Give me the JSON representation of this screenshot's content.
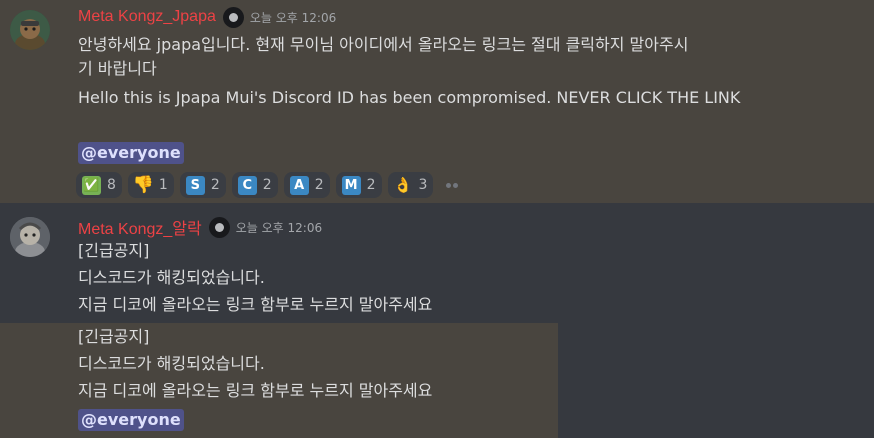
{
  "messages": [
    {
      "username": "Meta Kongz_Jpapa",
      "timestamp": "오늘 오후 12:06",
      "lines": [
        "안녕하세요 jpapa입니다. 현재 무이님 아이디에서 올라오는 링크는 절대 클릭하지 말아주시",
        "기 바랍니다",
        "Hello this is Jpapa Mui's Discord ID has been compromised. NEVER CLICK THE LINK"
      ],
      "mention": "@everyone",
      "reactions": [
        {
          "emoji": "✅",
          "count": "8"
        },
        {
          "emoji": "👎",
          "count": "1"
        },
        {
          "emoji": "S",
          "count": "2"
        },
        {
          "emoji": "C",
          "count": "2"
        },
        {
          "emoji": "A",
          "count": "2"
        },
        {
          "emoji": "M",
          "count": "2"
        },
        {
          "emoji": "👌",
          "count": "3"
        }
      ]
    },
    {
      "username": "Meta Kongz_알락",
      "timestamp": "오늘 오후 12:06",
      "lines": [
        "[긴급공지]",
        "디스코드가 해킹되었습니다.",
        "지금 디코에 올라오는 링크 함부로 누르지 말아주세요"
      ]
    },
    {
      "lines": [
        "[긴급공지]",
        "디스코드가 해킹되었습니다.",
        "지금 디코에 올라오는 링크 함부로 누르지 말아주세요"
      ],
      "mention": "@everyone"
    }
  ],
  "colors": {
    "username": "#ed4245",
    "highlight_bg": "#49453f",
    "app_bg": "#36393f",
    "mention_bg": "#5865f2"
  }
}
